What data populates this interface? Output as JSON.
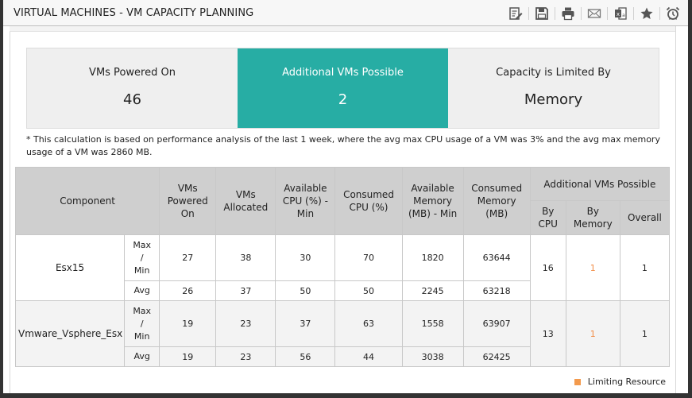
{
  "header": {
    "title": "VIRTUAL MACHINES - VM CAPACITY PLANNING",
    "toolbar": [
      {
        "name": "edit-report-icon"
      },
      {
        "name": "save-icon"
      },
      {
        "name": "print-icon"
      },
      {
        "name": "email-icon"
      },
      {
        "name": "excel-export-icon"
      },
      {
        "name": "favorite-star-icon"
      },
      {
        "name": "alarm-clock-icon"
      }
    ]
  },
  "kpis": [
    {
      "label": "VMs Powered On",
      "value": "46"
    },
    {
      "label": "Additional VMs Possible",
      "value": "2"
    },
    {
      "label": "Capacity is Limited By",
      "value": "Memory"
    }
  ],
  "note": "* This calculation is based on performance analysis of the last 1 week, where the avg max CPU usage of a VM was 3% and the avg max memory usage of a VM was 2860 MB.",
  "table": {
    "headers": {
      "component": "Component",
      "vms_powered_on": "VMs Powered On",
      "vms_allocated": "VMs Allocated",
      "available_cpu": "Available CPU (%) - Min",
      "consumed_cpu": "Consumed CPU (%)",
      "available_memory": "Available Memory (MB) - Min",
      "consumed_memory": "Consumed Memory (MB)",
      "additional": "Additional VMs Possible",
      "by_cpu": "By CPU",
      "by_memory": "By Memory",
      "overall": "Overall"
    },
    "rows": [
      {
        "component": "Esx15",
        "max_label": "Max / Min",
        "avg_label": "Avg",
        "max": {
          "vms_powered_on": "27",
          "vms_allocated": "38",
          "available_cpu": "30",
          "consumed_cpu": "70",
          "available_memory": "1820",
          "consumed_memory": "63644"
        },
        "avg": {
          "vms_powered_on": "26",
          "vms_allocated": "37",
          "available_cpu": "50",
          "consumed_cpu": "50",
          "available_memory": "2245",
          "consumed_memory": "63218"
        },
        "by_cpu": "16",
        "by_memory": "1",
        "overall": "1"
      },
      {
        "component": "Vmware_Vsphere_Esx",
        "max_label": "Max / Min",
        "avg_label": "Avg",
        "max": {
          "vms_powered_on": "19",
          "vms_allocated": "23",
          "available_cpu": "37",
          "consumed_cpu": "63",
          "available_memory": "1558",
          "consumed_memory": "63907"
        },
        "avg": {
          "vms_powered_on": "19",
          "vms_allocated": "23",
          "available_cpu": "56",
          "consumed_cpu": "44",
          "available_memory": "3038",
          "consumed_memory": "62425"
        },
        "by_cpu": "13",
        "by_memory": "1",
        "overall": "1"
      }
    ]
  },
  "legend": {
    "label": "Limiting Resource",
    "color": "#f39a4d"
  },
  "colors": {
    "accent": "#27ada4",
    "limiting": "#f28f4a"
  }
}
